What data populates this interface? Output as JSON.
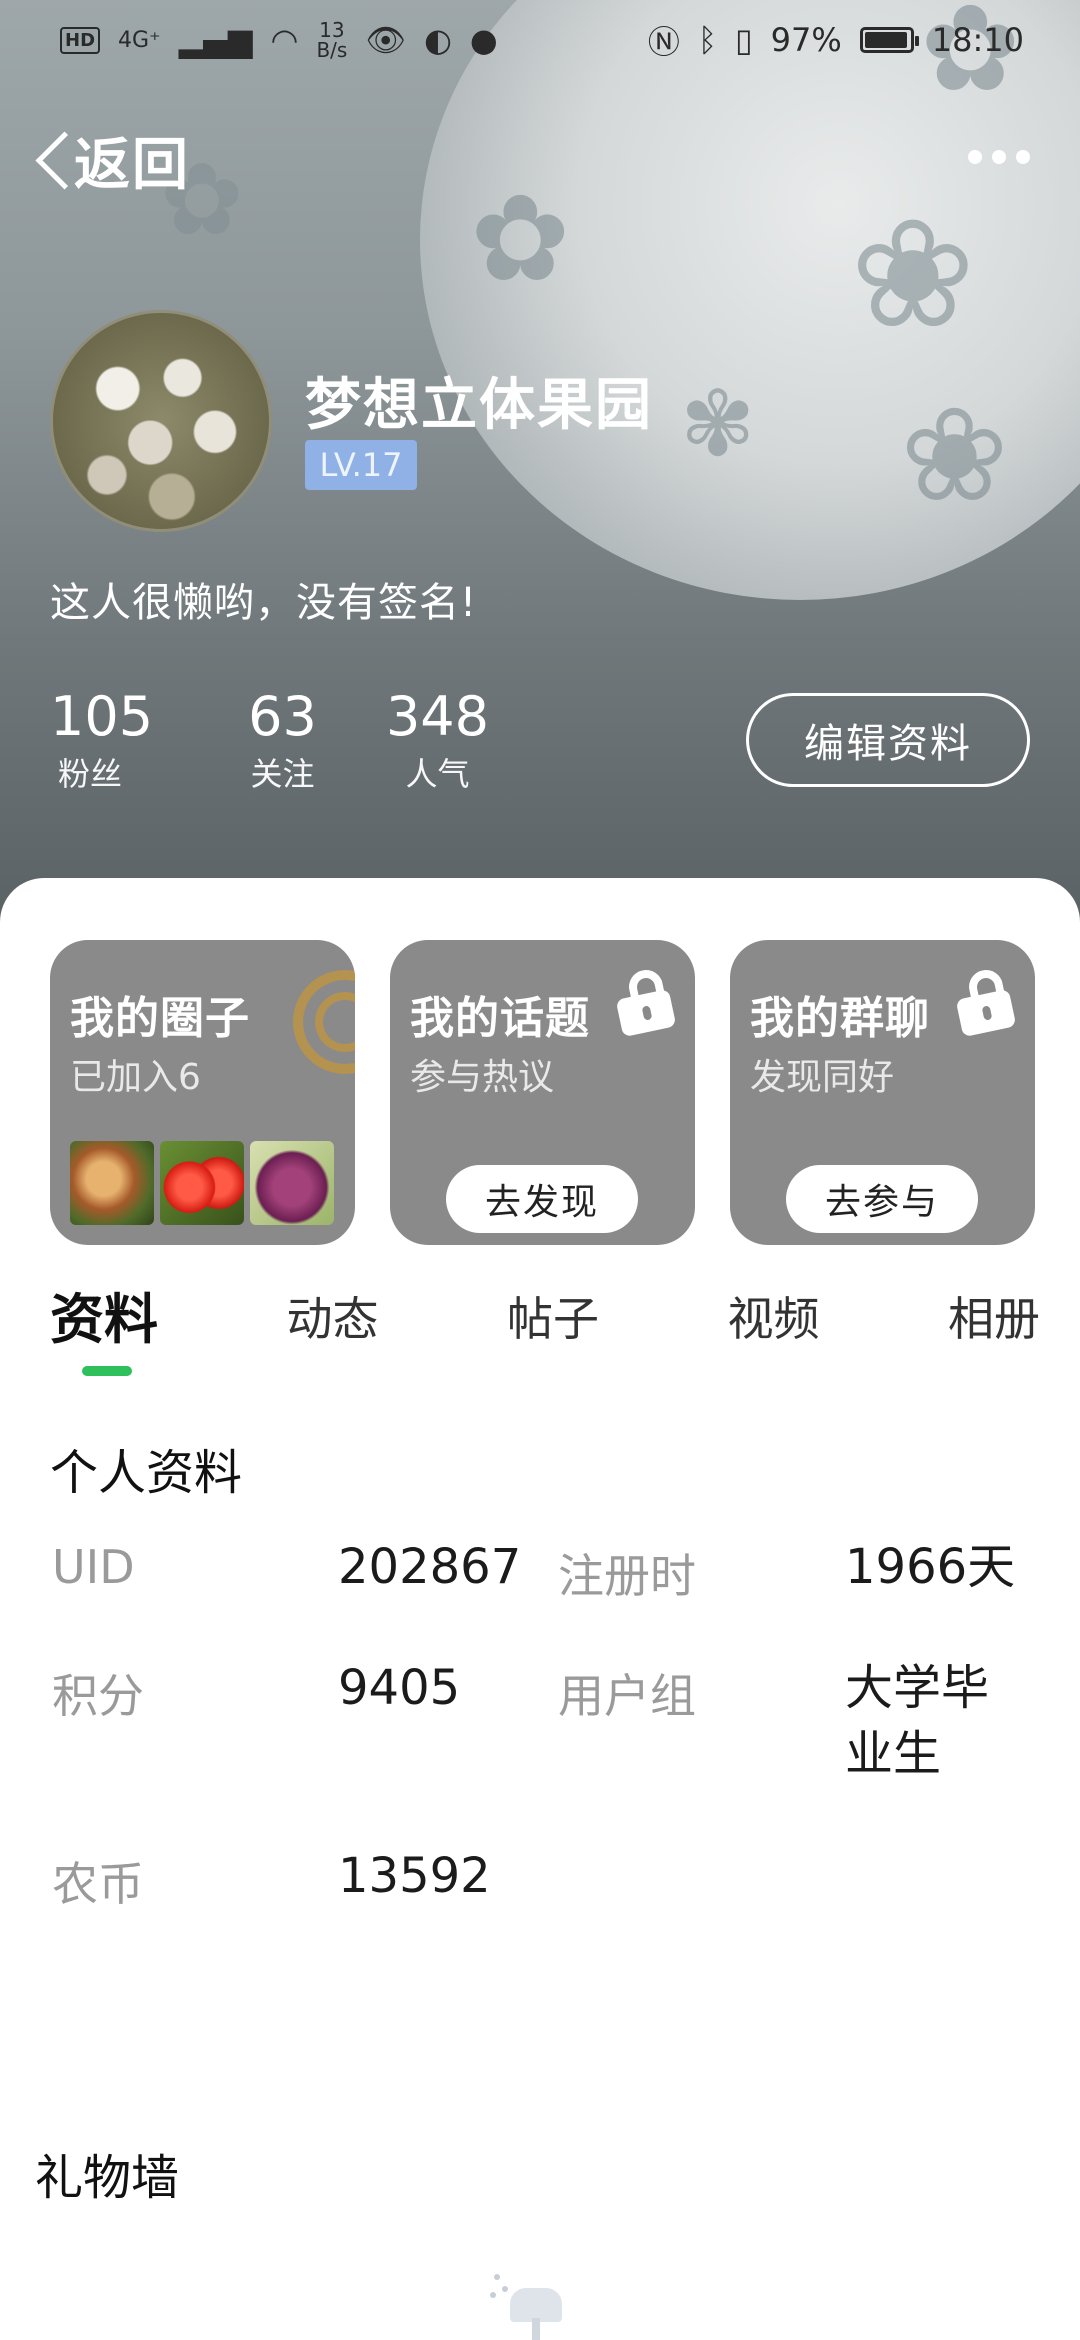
{
  "status_bar": {
    "hd": "HD",
    "network": "4G⁺",
    "speed_top": "13",
    "speed_bottom": "B/s",
    "battery": "97%",
    "time": "18:10"
  },
  "nav": {
    "back_label": "返回"
  },
  "profile": {
    "username": "梦想立体果园",
    "level": "LV.17",
    "signature": "这人很懒哟，没有签名!",
    "stats": [
      {
        "value": "105",
        "label": "粉丝"
      },
      {
        "value": "63",
        "label": "关注"
      },
      {
        "value": "348",
        "label": "人气"
      }
    ],
    "edit_button": "编辑资料"
  },
  "cards": [
    {
      "title": "我的圈子",
      "subtitle": "已加入6"
    },
    {
      "title": "我的话题",
      "subtitle": "参与热议",
      "button": "去发现"
    },
    {
      "title": "我的群聊",
      "subtitle": "发现同好",
      "button": "去参与"
    }
  ],
  "tabs": [
    "资料",
    "动态",
    "帖子",
    "视频",
    "相册"
  ],
  "profile_info": {
    "title": "个人资料",
    "uid_label": "UID",
    "uid_value": "202867",
    "reg_label": "注册时",
    "reg_value": "1966天",
    "points_label": "积分",
    "points_value": "9405",
    "group_label": "用户组",
    "group_value_line1": "大学毕",
    "group_value_line2": "业生",
    "coins_label": "农币",
    "coins_value": "13592"
  },
  "gift_wall": {
    "title": "礼物墙"
  },
  "colors": {
    "accent_green": "#2fbf5b",
    "level_badge": "#8fb1e6",
    "card_bg": "#8a8a8a"
  },
  "battery_level": 0.97
}
